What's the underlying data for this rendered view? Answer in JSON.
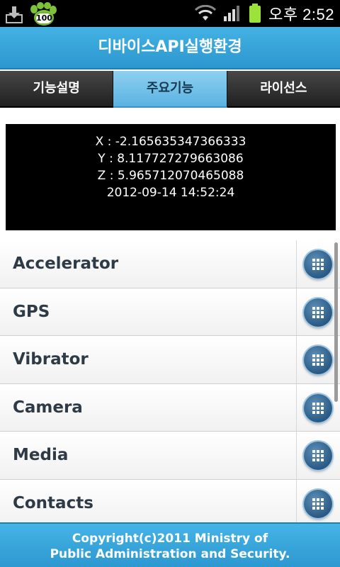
{
  "status_bar": {
    "time": "오후 2:52",
    "notification_badge": "100",
    "icons": [
      "download-icon",
      "paw-icon",
      "wifi-icon",
      "signal-icon",
      "battery-icon"
    ],
    "battery_color": "#9be33b"
  },
  "app": {
    "title": "디바이스API실행환경",
    "accent_color": "#3aa9dc"
  },
  "tabs": [
    {
      "label": "기능설명",
      "active": false
    },
    {
      "label": "주요기능",
      "active": true
    },
    {
      "label": "라이선스",
      "active": false
    }
  ],
  "sensor": {
    "x": "X : -2.165635347366333",
    "y": "Y : 8.117727279663086",
    "z": "Z : 5.965712070465088",
    "timestamp": "2012-09-14 14:52:24"
  },
  "features": [
    {
      "label": "Accelerator",
      "icon": "grid-icon"
    },
    {
      "label": "GPS",
      "icon": "grid-icon"
    },
    {
      "label": "Vibrator",
      "icon": "grid-icon"
    },
    {
      "label": "Camera",
      "icon": "grid-icon"
    },
    {
      "label": "Media",
      "icon": "grid-icon"
    },
    {
      "label": "Contacts",
      "icon": "grid-icon"
    }
  ],
  "footer": {
    "line1": "Copyright(c)2011 Ministry of",
    "line2": "Public Administration and Security."
  }
}
